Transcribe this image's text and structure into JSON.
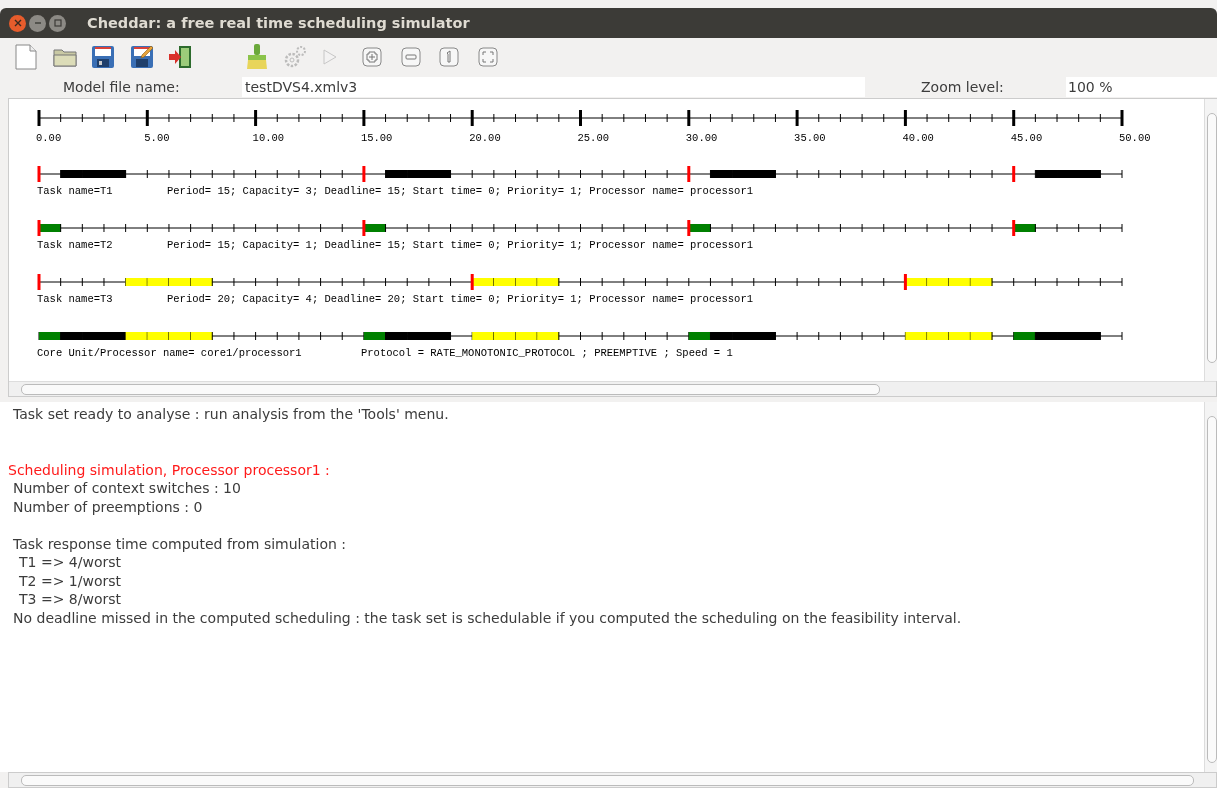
{
  "window": {
    "title": "Cheddar: a free real time scheduling simulator"
  },
  "toolbar": [
    {
      "kind": "new",
      "disabled": false
    },
    {
      "kind": "open",
      "disabled": false
    },
    {
      "kind": "save",
      "disabled": false
    },
    {
      "kind": "save-as",
      "disabled": false
    },
    {
      "kind": "exit",
      "disabled": false
    },
    {
      "kind": "clean",
      "disabled": false
    },
    {
      "kind": "settings",
      "disabled": true
    },
    {
      "kind": "run",
      "disabled": true
    },
    {
      "kind": "zoom-in",
      "disabled": false
    },
    {
      "kind": "zoom-out",
      "disabled": false
    },
    {
      "kind": "zoom-reset",
      "disabled": false
    },
    {
      "kind": "zoom-fit",
      "disabled": false
    }
  ],
  "model_file": {
    "label": "Model file name:",
    "value": "testDVS4.xmlv3"
  },
  "zoom": {
    "label": "Zoom level:",
    "value": "100 %"
  },
  "gantt": {
    "axis_labels": [
      "0.00",
      "5.00",
      "10.00",
      "15.00",
      "20.00",
      "25.00",
      "30.00",
      "35.00",
      "40.00",
      "45.00",
      "50.00"
    ],
    "rows": [
      {
        "kind": "task",
        "name": "Task name=T1",
        "info": "Period= 15; Capacity= 3; Deadline= 15; Start time= 0; Priority= 1; Processor name= processor1",
        "slots": [
          {
            "busy": false,
            "release": true
          },
          {
            "busy": true,
            "color": "#000000",
            "release": false
          },
          {
            "busy": true,
            "color": "#000000",
            "release": false
          },
          {
            "busy": true,
            "color": "#000000",
            "release": false
          },
          {
            "busy": false,
            "release": false
          },
          {
            "busy": false,
            "release": false
          },
          {
            "busy": false,
            "release": false
          },
          {
            "busy": false,
            "release": false
          },
          {
            "busy": false,
            "release": false
          },
          {
            "busy": false,
            "release": false
          },
          {
            "busy": false,
            "release": false
          },
          {
            "busy": false,
            "release": false
          },
          {
            "busy": false,
            "release": false
          },
          {
            "busy": false,
            "release": false
          },
          {
            "busy": false,
            "release": false
          },
          {
            "busy": false,
            "release": true
          },
          {
            "busy": true,
            "color": "#000000",
            "release": false
          },
          {
            "busy": true,
            "color": "#000000",
            "release": false
          },
          {
            "busy": true,
            "color": "#000000",
            "release": false
          },
          {
            "busy": false,
            "release": false
          },
          {
            "busy": false,
            "release": false
          },
          {
            "busy": false,
            "release": false
          },
          {
            "busy": false,
            "release": false
          },
          {
            "busy": false,
            "release": false
          },
          {
            "busy": false,
            "release": false
          },
          {
            "busy": false,
            "release": false
          },
          {
            "busy": false,
            "release": false
          },
          {
            "busy": false,
            "release": false
          },
          {
            "busy": false,
            "release": false
          },
          {
            "busy": false,
            "release": false
          },
          {
            "busy": false,
            "release": true
          },
          {
            "busy": true,
            "color": "#000000",
            "release": false
          },
          {
            "busy": true,
            "color": "#000000",
            "release": false
          },
          {
            "busy": true,
            "color": "#000000",
            "release": false
          },
          {
            "busy": false,
            "release": false
          },
          {
            "busy": false,
            "release": false
          },
          {
            "busy": false,
            "release": false
          },
          {
            "busy": false,
            "release": false
          },
          {
            "busy": false,
            "release": false
          },
          {
            "busy": false,
            "release": false
          },
          {
            "busy": false,
            "release": false
          },
          {
            "busy": false,
            "release": false
          },
          {
            "busy": false,
            "release": false
          },
          {
            "busy": false,
            "release": false
          },
          {
            "busy": false,
            "release": false
          },
          {
            "busy": false,
            "release": true
          },
          {
            "busy": true,
            "color": "#000000",
            "release": false
          },
          {
            "busy": true,
            "color": "#000000",
            "release": false
          },
          {
            "busy": true,
            "color": "#000000",
            "release": false
          },
          {
            "busy": false,
            "release": false
          }
        ]
      },
      {
        "kind": "task",
        "name": "Task name=T2",
        "info": "Period= 15; Capacity= 1; Deadline= 15; Start time= 0; Priority= 1; Processor name= processor1",
        "slots": [
          {
            "busy": true,
            "color": "#008000",
            "release": true
          },
          {
            "busy": false,
            "release": false
          },
          {
            "busy": false,
            "release": false
          },
          {
            "busy": false,
            "release": false
          },
          {
            "busy": false,
            "release": false
          },
          {
            "busy": false,
            "release": false
          },
          {
            "busy": false,
            "release": false
          },
          {
            "busy": false,
            "release": false
          },
          {
            "busy": false,
            "release": false
          },
          {
            "busy": false,
            "release": false
          },
          {
            "busy": false,
            "release": false
          },
          {
            "busy": false,
            "release": false
          },
          {
            "busy": false,
            "release": false
          },
          {
            "busy": false,
            "release": false
          },
          {
            "busy": false,
            "release": false
          },
          {
            "busy": true,
            "color": "#008000",
            "release": true
          },
          {
            "busy": false,
            "release": false
          },
          {
            "busy": false,
            "release": false
          },
          {
            "busy": false,
            "release": false
          },
          {
            "busy": false,
            "release": false
          },
          {
            "busy": false,
            "release": false
          },
          {
            "busy": false,
            "release": false
          },
          {
            "busy": false,
            "release": false
          },
          {
            "busy": false,
            "release": false
          },
          {
            "busy": false,
            "release": false
          },
          {
            "busy": false,
            "release": false
          },
          {
            "busy": false,
            "release": false
          },
          {
            "busy": false,
            "release": false
          },
          {
            "busy": false,
            "release": false
          },
          {
            "busy": false,
            "release": false
          },
          {
            "busy": true,
            "color": "#008000",
            "release": true
          },
          {
            "busy": false,
            "release": false
          },
          {
            "busy": false,
            "release": false
          },
          {
            "busy": false,
            "release": false
          },
          {
            "busy": false,
            "release": false
          },
          {
            "busy": false,
            "release": false
          },
          {
            "busy": false,
            "release": false
          },
          {
            "busy": false,
            "release": false
          },
          {
            "busy": false,
            "release": false
          },
          {
            "busy": false,
            "release": false
          },
          {
            "busy": false,
            "release": false
          },
          {
            "busy": false,
            "release": false
          },
          {
            "busy": false,
            "release": false
          },
          {
            "busy": false,
            "release": false
          },
          {
            "busy": false,
            "release": false
          },
          {
            "busy": true,
            "color": "#008000",
            "release": true
          },
          {
            "busy": false,
            "release": false
          },
          {
            "busy": false,
            "release": false
          },
          {
            "busy": false,
            "release": false
          },
          {
            "busy": false,
            "release": false
          }
        ]
      },
      {
        "kind": "task",
        "name": "Task name=T3",
        "info": "Period= 20; Capacity= 4; Deadline= 20; Start time= 0; Priority= 1; Processor name= processor1",
        "slots": [
          {
            "busy": false,
            "release": true
          },
          {
            "busy": false,
            "release": false
          },
          {
            "busy": false,
            "release": false
          },
          {
            "busy": false,
            "release": false
          },
          {
            "busy": true,
            "color": "#ffff00",
            "release": false
          },
          {
            "busy": true,
            "color": "#ffff00",
            "release": false
          },
          {
            "busy": true,
            "color": "#ffff00",
            "release": false
          },
          {
            "busy": true,
            "color": "#ffff00",
            "release": false
          },
          {
            "busy": false,
            "release": false
          },
          {
            "busy": false,
            "release": false
          },
          {
            "busy": false,
            "release": false
          },
          {
            "busy": false,
            "release": false
          },
          {
            "busy": false,
            "release": false
          },
          {
            "busy": false,
            "release": false
          },
          {
            "busy": false,
            "release": false
          },
          {
            "busy": false,
            "release": false
          },
          {
            "busy": false,
            "release": false
          },
          {
            "busy": false,
            "release": false
          },
          {
            "busy": false,
            "release": false
          },
          {
            "busy": false,
            "release": false
          },
          {
            "busy": true,
            "color": "#ffff00",
            "release": true
          },
          {
            "busy": true,
            "color": "#ffff00",
            "release": false
          },
          {
            "busy": true,
            "color": "#ffff00",
            "release": false
          },
          {
            "busy": true,
            "color": "#ffff00",
            "release": false
          },
          {
            "busy": false,
            "release": false
          },
          {
            "busy": false,
            "release": false
          },
          {
            "busy": false,
            "release": false
          },
          {
            "busy": false,
            "release": false
          },
          {
            "busy": false,
            "release": false
          },
          {
            "busy": false,
            "release": false
          },
          {
            "busy": false,
            "release": false
          },
          {
            "busy": false,
            "release": false
          },
          {
            "busy": false,
            "release": false
          },
          {
            "busy": false,
            "release": false
          },
          {
            "busy": false,
            "release": false
          },
          {
            "busy": false,
            "release": false
          },
          {
            "busy": false,
            "release": false
          },
          {
            "busy": false,
            "release": false
          },
          {
            "busy": false,
            "release": false
          },
          {
            "busy": false,
            "release": false
          },
          {
            "busy": true,
            "color": "#ffff00",
            "release": true
          },
          {
            "busy": true,
            "color": "#ffff00",
            "release": false
          },
          {
            "busy": true,
            "color": "#ffff00",
            "release": false
          },
          {
            "busy": true,
            "color": "#ffff00",
            "release": false
          },
          {
            "busy": false,
            "release": false
          },
          {
            "busy": false,
            "release": false
          },
          {
            "busy": false,
            "release": false
          },
          {
            "busy": false,
            "release": false
          },
          {
            "busy": false,
            "release": false
          },
          {
            "busy": false,
            "release": false
          }
        ]
      },
      {
        "kind": "processor",
        "name": "Core Unit/Processor name= core1/processor1",
        "info": "Protocol = RATE_MONOTONIC_PROTOCOL ; PREEMPTIVE ; Speed =  1",
        "slots": [
          {
            "busy": true,
            "color": "#008000",
            "release": false
          },
          {
            "busy": true,
            "color": "#000000",
            "release": false
          },
          {
            "busy": true,
            "color": "#000000",
            "release": false
          },
          {
            "busy": true,
            "color": "#000000",
            "release": false
          },
          {
            "busy": true,
            "color": "#ffff00",
            "release": false
          },
          {
            "busy": true,
            "color": "#ffff00",
            "release": false
          },
          {
            "busy": true,
            "color": "#ffff00",
            "release": false
          },
          {
            "busy": true,
            "color": "#ffff00",
            "release": false
          },
          {
            "busy": false,
            "release": false
          },
          {
            "busy": false,
            "release": false
          },
          {
            "busy": false,
            "release": false
          },
          {
            "busy": false,
            "release": false
          },
          {
            "busy": false,
            "release": false
          },
          {
            "busy": false,
            "release": false
          },
          {
            "busy": false,
            "release": false
          },
          {
            "busy": true,
            "color": "#008000",
            "release": false
          },
          {
            "busy": true,
            "color": "#000000",
            "release": false
          },
          {
            "busy": true,
            "color": "#000000",
            "release": false
          },
          {
            "busy": true,
            "color": "#000000",
            "release": false
          },
          {
            "busy": false,
            "release": false
          },
          {
            "busy": true,
            "color": "#ffff00",
            "release": false
          },
          {
            "busy": true,
            "color": "#ffff00",
            "release": false
          },
          {
            "busy": true,
            "color": "#ffff00",
            "release": false
          },
          {
            "busy": true,
            "color": "#ffff00",
            "release": false
          },
          {
            "busy": false,
            "release": false
          },
          {
            "busy": false,
            "release": false
          },
          {
            "busy": false,
            "release": false
          },
          {
            "busy": false,
            "release": false
          },
          {
            "busy": false,
            "release": false
          },
          {
            "busy": false,
            "release": false
          },
          {
            "busy": true,
            "color": "#008000",
            "release": false
          },
          {
            "busy": true,
            "color": "#000000",
            "release": false
          },
          {
            "busy": true,
            "color": "#000000",
            "release": false
          },
          {
            "busy": true,
            "color": "#000000",
            "release": false
          },
          {
            "busy": false,
            "release": false
          },
          {
            "busy": false,
            "release": false
          },
          {
            "busy": false,
            "release": false
          },
          {
            "busy": false,
            "release": false
          },
          {
            "busy": false,
            "release": false
          },
          {
            "busy": false,
            "release": false
          },
          {
            "busy": true,
            "color": "#ffff00",
            "release": false
          },
          {
            "busy": true,
            "color": "#ffff00",
            "release": false
          },
          {
            "busy": true,
            "color": "#ffff00",
            "release": false
          },
          {
            "busy": true,
            "color": "#ffff00",
            "release": false
          },
          {
            "busy": false,
            "release": false
          },
          {
            "busy": true,
            "color": "#008000",
            "release": false
          },
          {
            "busy": true,
            "color": "#000000",
            "release": false
          },
          {
            "busy": true,
            "color": "#000000",
            "release": false
          },
          {
            "busy": true,
            "color": "#000000",
            "release": false
          },
          {
            "busy": false,
            "release": false
          }
        ]
      }
    ]
  },
  "log": [
    {
      "lines": [
        {
          "kind": "message",
          "text": "Task set ready to analyse : run analysis from the 'Tools' menu."
        }
      ]
    },
    {
      "lines": [
        {
          "kind": "heading",
          "text": "Scheduling simulation, Processor processor1 :"
        },
        {
          "kind": "message",
          "text": "Number of context switches :  10"
        },
        {
          "kind": "message",
          "text": "Number of preemptions :  0"
        }
      ]
    },
    {
      "lines": [
        {
          "kind": "message",
          "text": "Task response time computed from simulation :"
        },
        {
          "kind": "detail",
          "text": "T1 => 4/worst"
        },
        {
          "kind": "detail",
          "text": "T2 => 1/worst"
        },
        {
          "kind": "detail",
          "text": "T3 => 8/worst"
        },
        {
          "kind": "message",
          "text": "No deadline missed in the computed scheduling : the task set is schedulable if you computed the scheduling on the feasibility interval."
        }
      ]
    }
  ]
}
